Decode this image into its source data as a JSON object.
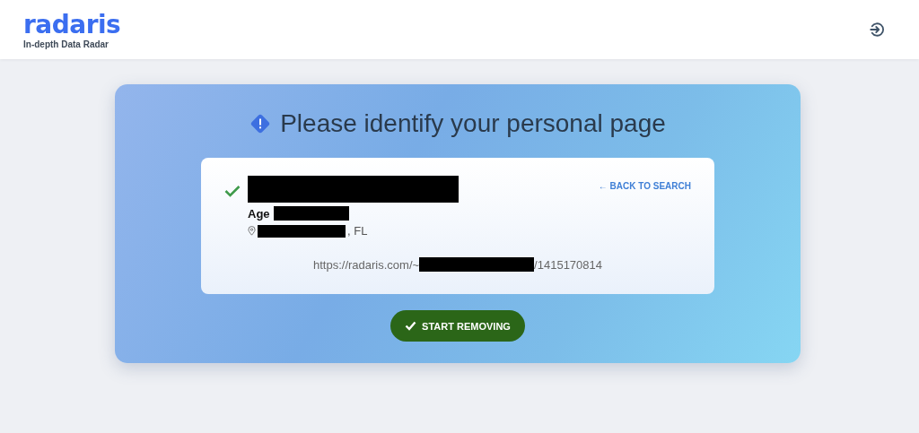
{
  "header": {
    "logo": "radaris",
    "tagline": "In-depth Data Radar"
  },
  "panel": {
    "title": "Please identify your personal page",
    "result": {
      "verified": true,
      "age_label": "Age",
      "location_suffix": ", FL",
      "back_link": "← BACK TO SEARCH",
      "url_prefix": "https://radaris.com/~",
      "url_suffix": "/1415170814"
    },
    "button": "START REMOVING"
  }
}
